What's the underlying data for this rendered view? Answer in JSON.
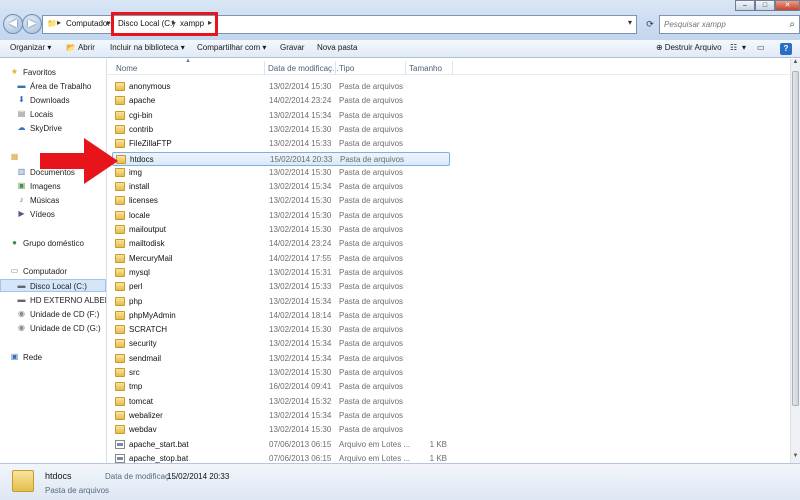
{
  "address": {
    "crumbs": [
      "Computador",
      "Disco Local (C:)",
      "xampp"
    ],
    "search_placeholder": "Pesquisar xampp"
  },
  "window_controls": {
    "minimize": "–",
    "maximize": "□",
    "close": "✕"
  },
  "toolbar": {
    "organize": "Organizar ▾",
    "open": "Abrir",
    "include_library": "Incluir na biblioteca ▾",
    "share": "Compartilhar com ▾",
    "burn": "Gravar",
    "new_folder": "Nova pasta",
    "destroy": "Destruir Arquivo",
    "view_options": "▾"
  },
  "nav": {
    "favorites": "Favoritos",
    "desktop": "Área de Trabalho",
    "downloads": "Downloads",
    "recent": "Locais",
    "skydrive": "SkyDrive",
    "libraries": "",
    "documents": "Documentos",
    "pictures": "Imagens",
    "music": "Músicas",
    "videos": "Vídeos",
    "homegroup": "Grupo doméstico",
    "computer": "Computador",
    "disk_c": "Disco Local (C:)",
    "hd_ext": "HD EXTERNO ALBERTO",
    "cd_f": "Unidade de CD (F:)",
    "cd_g": "Unidade de CD (G:)",
    "network": "Rede"
  },
  "columns": {
    "name": "Nome",
    "date": "Data de modificaç...",
    "type": "Tipo",
    "size": "Tamanho"
  },
  "files": [
    {
      "name": "anonymous",
      "date": "13/02/2014 15:30",
      "type": "Pasta de arquivos",
      "size": "",
      "kind": "folder"
    },
    {
      "name": "apache",
      "date": "14/02/2014 23:24",
      "type": "Pasta de arquivos",
      "size": "",
      "kind": "folder"
    },
    {
      "name": "cgi-bin",
      "date": "13/02/2014 15:34",
      "type": "Pasta de arquivos",
      "size": "",
      "kind": "folder"
    },
    {
      "name": "contrib",
      "date": "13/02/2014 15:30",
      "type": "Pasta de arquivos",
      "size": "",
      "kind": "folder"
    },
    {
      "name": "FileZillaFTP",
      "date": "13/02/2014 15:33",
      "type": "Pasta de arquivos",
      "size": "",
      "kind": "folder"
    },
    {
      "name": "htdocs",
      "date": "15/02/2014 20:33",
      "type": "Pasta de arquivos",
      "size": "",
      "kind": "folder"
    },
    {
      "name": "img",
      "date": "13/02/2014 15:30",
      "type": "Pasta de arquivos",
      "size": "",
      "kind": "folder"
    },
    {
      "name": "install",
      "date": "13/02/2014 15:34",
      "type": "Pasta de arquivos",
      "size": "",
      "kind": "folder"
    },
    {
      "name": "licenses",
      "date": "13/02/2014 15:30",
      "type": "Pasta de arquivos",
      "size": "",
      "kind": "folder"
    },
    {
      "name": "locale",
      "date": "13/02/2014 15:30",
      "type": "Pasta de arquivos",
      "size": "",
      "kind": "folder"
    },
    {
      "name": "mailoutput",
      "date": "13/02/2014 15:30",
      "type": "Pasta de arquivos",
      "size": "",
      "kind": "folder"
    },
    {
      "name": "mailtodisk",
      "date": "14/02/2014 23:24",
      "type": "Pasta de arquivos",
      "size": "",
      "kind": "folder"
    },
    {
      "name": "MercuryMail",
      "date": "14/02/2014 17:55",
      "type": "Pasta de arquivos",
      "size": "",
      "kind": "folder"
    },
    {
      "name": "mysql",
      "date": "13/02/2014 15:31",
      "type": "Pasta de arquivos",
      "size": "",
      "kind": "folder"
    },
    {
      "name": "perl",
      "date": "13/02/2014 15:33",
      "type": "Pasta de arquivos",
      "size": "",
      "kind": "folder"
    },
    {
      "name": "php",
      "date": "13/02/2014 15:34",
      "type": "Pasta de arquivos",
      "size": "",
      "kind": "folder"
    },
    {
      "name": "phpMyAdmin",
      "date": "14/02/2014 18:14",
      "type": "Pasta de arquivos",
      "size": "",
      "kind": "folder"
    },
    {
      "name": "SCRATCH",
      "date": "13/02/2014 15:30",
      "type": "Pasta de arquivos",
      "size": "",
      "kind": "folder"
    },
    {
      "name": "security",
      "date": "13/02/2014 15:34",
      "type": "Pasta de arquivos",
      "size": "",
      "kind": "folder"
    },
    {
      "name": "sendmail",
      "date": "13/02/2014 15:34",
      "type": "Pasta de arquivos",
      "size": "",
      "kind": "folder"
    },
    {
      "name": "src",
      "date": "13/02/2014 15:30",
      "type": "Pasta de arquivos",
      "size": "",
      "kind": "folder"
    },
    {
      "name": "tmp",
      "date": "16/02/2014 09:41",
      "type": "Pasta de arquivos",
      "size": "",
      "kind": "folder"
    },
    {
      "name": "tomcat",
      "date": "13/02/2014 15:32",
      "type": "Pasta de arquivos",
      "size": "",
      "kind": "folder"
    },
    {
      "name": "webalizer",
      "date": "13/02/2014 15:34",
      "type": "Pasta de arquivos",
      "size": "",
      "kind": "folder"
    },
    {
      "name": "webdav",
      "date": "13/02/2014 15:30",
      "type": "Pasta de arquivos",
      "size": "",
      "kind": "folder"
    },
    {
      "name": "apache_start.bat",
      "date": "07/06/2013 06:15",
      "type": "Arquivo em Lotes ...",
      "size": "1 KB",
      "kind": "bat"
    },
    {
      "name": "apache_stop.bat",
      "date": "07/06/2013 06:15",
      "type": "Arquivo em Lotes ...",
      "size": "1 KB",
      "kind": "bat"
    }
  ],
  "selected_index": 5,
  "details": {
    "name": "htdocs",
    "type": "Pasta de arquivos",
    "date_label": "Data de modificaç...",
    "date": "15/02/2014 20:33"
  },
  "colors": {
    "annotation_red": "#e8141b",
    "selection_blue": "#84acdd"
  }
}
